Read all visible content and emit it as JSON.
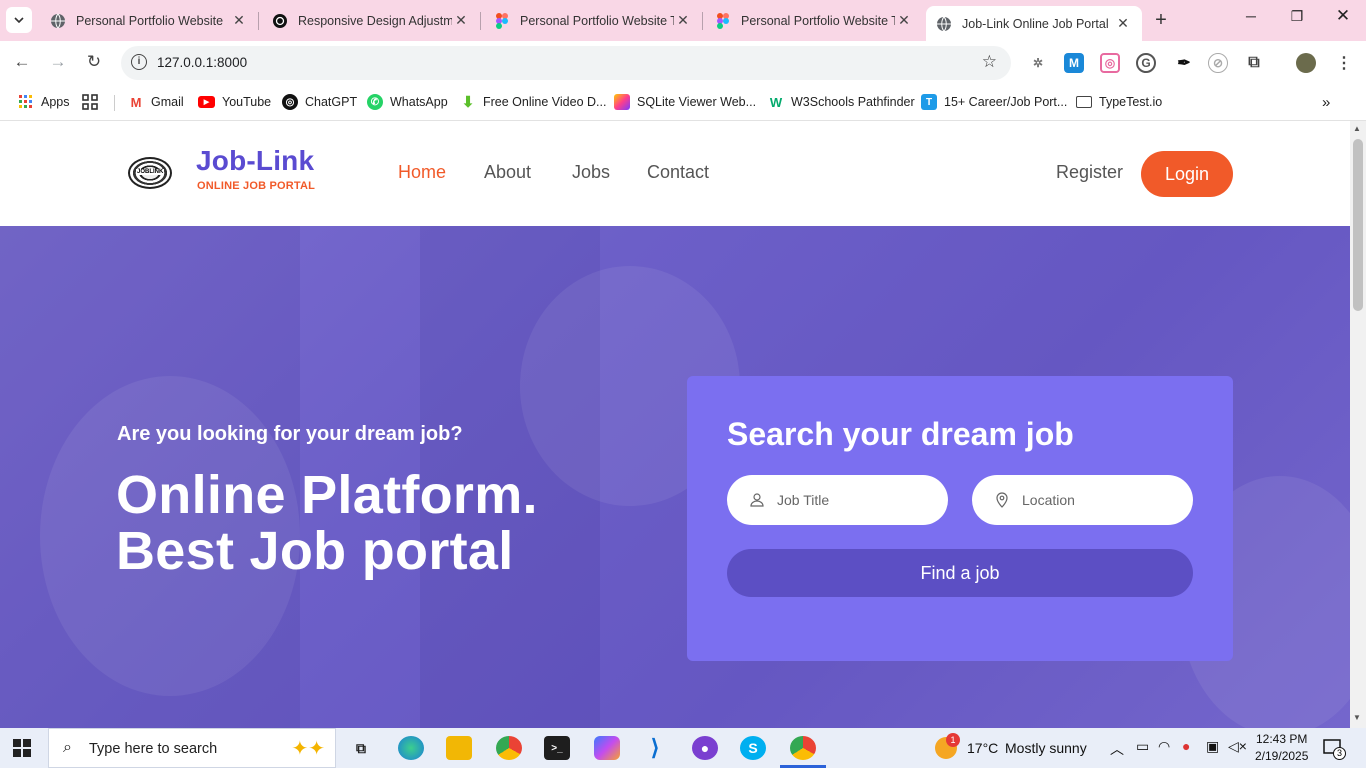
{
  "browser": {
    "tabs": [
      {
        "title": "Personal Portfolio Website",
        "icon": "globe-icon"
      },
      {
        "title": "Responsive Design Adjustme",
        "icon": "chatgpt-icon"
      },
      {
        "title": "Personal Portfolio Website Te",
        "icon": "figma-icon"
      },
      {
        "title": "Personal Portfolio Website Te",
        "icon": "figma-icon"
      },
      {
        "title": "Job-Link Online Job Portal",
        "icon": "globe-icon",
        "active": true
      }
    ],
    "url": "127.0.0.1:8000",
    "bookmarks": [
      {
        "label": "Apps",
        "icon": "apps-grid-icon"
      },
      {
        "label": "",
        "icon": "tab-groups-icon"
      },
      {
        "label": "Gmail",
        "icon": "gmail-icon"
      },
      {
        "label": "YouTube",
        "icon": "youtube-icon"
      },
      {
        "label": "ChatGPT",
        "icon": "chatgpt-icon"
      },
      {
        "label": "WhatsApp",
        "icon": "whatsapp-icon"
      },
      {
        "label": "Free Online Video D...",
        "icon": "download-icon"
      },
      {
        "label": "SQLite Viewer Web...",
        "icon": "sqlite-icon"
      },
      {
        "label": "W3Schools Pathfinder",
        "icon": "w3schools-icon"
      },
      {
        "label": "15+ Career/Job Port...",
        "icon": "t-logo-icon"
      },
      {
        "label": "TypeTest.io",
        "icon": "keyboard-icon"
      }
    ]
  },
  "site": {
    "brand": {
      "name": "Job-Link",
      "tagline": "ONLINE JOB PORTAL",
      "emblem_text": "JOBLINK"
    },
    "nav": [
      {
        "label": "Home",
        "active": true
      },
      {
        "label": "About"
      },
      {
        "label": "Jobs"
      },
      {
        "label": "Contact"
      }
    ],
    "register_label": "Register",
    "login_label": "Login",
    "accent_color": "#f15a29",
    "brand_color": "#5a4bd1"
  },
  "hero": {
    "kicker": "Are you looking for your dream job?",
    "title_line1": "Online Platform.",
    "title_line2": "Best Job portal",
    "search": {
      "heading": "Search your dream job",
      "job_title_placeholder": "Job Title",
      "location_placeholder": "Location",
      "button_label": "Find a job"
    }
  },
  "taskbar": {
    "search_placeholder": "Type here to search",
    "weather_temp": "17°C",
    "weather_desc": "Mostly sunny",
    "time": "12:43 PM",
    "date": "2/19/2025",
    "notification_count": "3",
    "weather_badge": "1"
  }
}
